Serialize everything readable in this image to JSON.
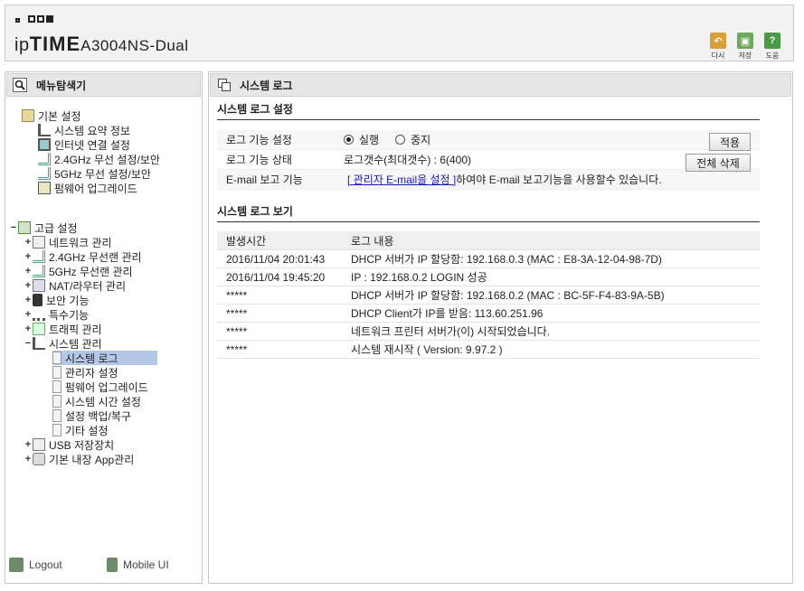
{
  "header": {
    "brand_prefix": "ip",
    "brand_bold": "TIME",
    "model": "A3004NS-Dual",
    "buttons": [
      {
        "label": "다시",
        "icon": "undo-icon",
        "color": "#d9a03a"
      },
      {
        "label": "저장",
        "icon": "save-icon",
        "color": "#6ea85c"
      },
      {
        "label": "도움",
        "icon": "help-icon",
        "color": "#4a9a4a"
      }
    ]
  },
  "sidebar": {
    "title": "메뉴탐색기",
    "basic": {
      "label": "기본 설정",
      "items": [
        "시스템 요약 정보",
        "인터넷 연결 설정",
        "2.4GHz 무선 설정/보안",
        "5GHz 무선 설정/보안",
        "펌웨어 업그레이드"
      ]
    },
    "advanced": {
      "label": "고급 설정",
      "items": [
        "네트워크 관리",
        "2.4GHz 무선랜 관리",
        "5GHz 무선랜 관리",
        "NAT/라우터 관리",
        "보안 기능",
        "특수기능",
        "트래픽 관리",
        "시스템 관리"
      ]
    },
    "system_sub": [
      "시스템 로그",
      "관리자 설정",
      "펌웨어 업그레이드",
      "시스템 시간 설정",
      "설정 백업/복구",
      "기타 설정"
    ],
    "after": [
      "USB 저장장치",
      "기본 내장 App관리"
    ],
    "footer": {
      "logout": "Logout",
      "mobile": "Mobile UI"
    }
  },
  "main": {
    "title": "시스템 로그",
    "settings_title": "시스템 로그 설정",
    "settings": {
      "row1_label": "로그 기능 설정",
      "radio_on": "실행",
      "radio_off": "중지",
      "apply_button": "적용",
      "row2_label": "로그 기능 상태",
      "row2_value": "로그갯수(최대갯수) : 6(400)",
      "clear_button": "전체 삭제",
      "row3_label": "E-mail 보고 기능",
      "row3_link": "[ 관리자 E-mail을 설정 ]",
      "row3_text": "하여야 E-mail 보고기능을 사용할수 있습니다."
    },
    "view_title": "시스템 로그 보기",
    "log_headers": {
      "time": "발생시간",
      "content": "로그 내용"
    },
    "log_rows": [
      {
        "time": "2016/11/04 20:01:43",
        "content": "DHCP 서버가 IP 할당함: 192.168.0.3 (MAC : E8-3A-12-04-98-7D)"
      },
      {
        "time": "2016/11/04 19:45:20",
        "content": "IP : 192.168.0.2 LOGIN 성공"
      },
      {
        "time": "*****",
        "content": "DHCP 서버가 IP 할당함: 192.168.0.2 (MAC : BC-5F-F4-83-9A-5B)"
      },
      {
        "time": "*****",
        "content": "DHCP Client가 IP를 받음: 113.60.251.96"
      },
      {
        "time": "*****",
        "content": "네트워크 프린터 서버가(이) 시작되었습니다."
      },
      {
        "time": "*****",
        "content": "시스템 재시작 ( Version: 9.97.2 )"
      }
    ]
  }
}
